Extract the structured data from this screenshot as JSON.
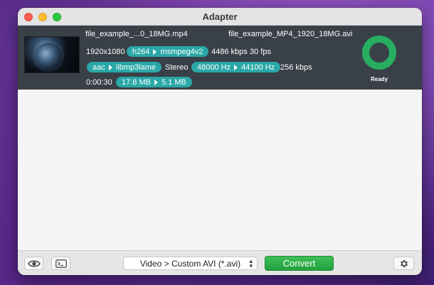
{
  "window": {
    "title": "Adapter"
  },
  "file": {
    "source_name": "file_example_...0_18MG.mp4",
    "output_name": "file_example_MP4_1920_18MG.avi",
    "resolution": "1920x1080",
    "video_codec_from": "h264",
    "video_codec_to": "msmpeg4v2",
    "video_bitrate": "4486 kbps",
    "fps": "30 fps",
    "audio_codec_from": "aac",
    "audio_codec_to": "libmp3lame",
    "channels": "Stereo",
    "sample_rate_from": "48000 Hz",
    "sample_rate_to": "44100 Hz",
    "audio_bitrate": "256 kbps",
    "duration": "0:00:30",
    "size_from": "17.8 MB",
    "size_to": "5.1 MB",
    "status": "Ready",
    "status_color": "#27ae60"
  },
  "toolbar": {
    "preview_icon": "eye-icon",
    "terminal_icon": "terminal-icon",
    "preset_value": "Video > Custom AVI (*.avi)",
    "convert_label": "Convert",
    "settings_icon": "gear-icon"
  },
  "colors": {
    "pill": "#2aa7a7",
    "row_bg": "#394048",
    "convert": "#2db24a"
  }
}
